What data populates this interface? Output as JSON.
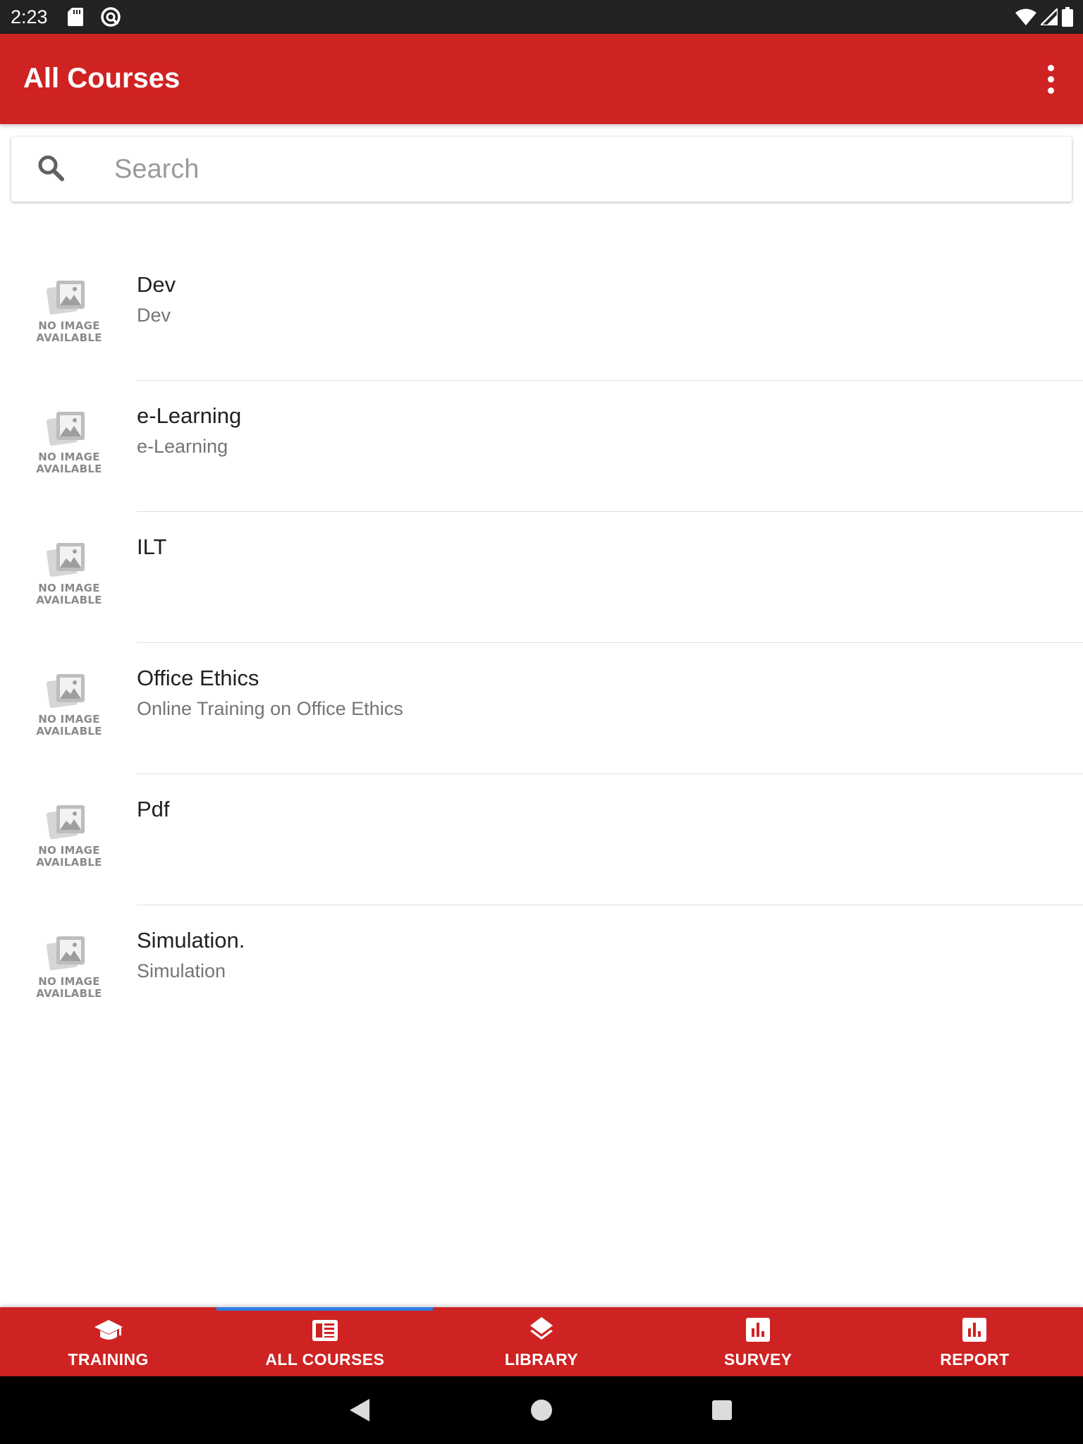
{
  "status_bar": {
    "time": "2:23",
    "icons": [
      "sd-card-icon",
      "app-notification-icon",
      "wifi-icon",
      "signal-icon",
      "battery-icon"
    ]
  },
  "app_bar": {
    "title": "All Courses",
    "menu_icon": "more-vert-icon"
  },
  "search": {
    "placeholder": "Search",
    "value": "",
    "icon": "search-icon"
  },
  "placeholder_image": {
    "line1": "NO IMAGE",
    "line2": "AVAILABLE"
  },
  "courses": [
    {
      "title": "Dev",
      "subtitle": "Dev"
    },
    {
      "title": "e-Learning",
      "subtitle": "e-Learning"
    },
    {
      "title": "ILT",
      "subtitle": ""
    },
    {
      "title": "Office Ethics",
      "subtitle": "Online Training on Office Ethics"
    },
    {
      "title": "Pdf",
      "subtitle": ""
    },
    {
      "title": "Simulation.",
      "subtitle": "Simulation"
    }
  ],
  "bottom_nav": {
    "items": [
      {
        "label": "TRAINING",
        "icon": "graduation-cap-icon",
        "active": false
      },
      {
        "label": "ALL COURSES",
        "icon": "courses-list-icon",
        "active": true
      },
      {
        "label": "LIBRARY",
        "icon": "layers-icon",
        "active": false
      },
      {
        "label": "SURVEY",
        "icon": "bar-chart-icon",
        "active": false
      },
      {
        "label": "REPORT",
        "icon": "bar-chart-icon",
        "active": false
      }
    ]
  },
  "colors": {
    "primary": "#cf2222",
    "active_indicator": "#2f7fe0",
    "status_bar": "#222222",
    "title_text": "#212121",
    "subtitle_text": "#757575"
  }
}
